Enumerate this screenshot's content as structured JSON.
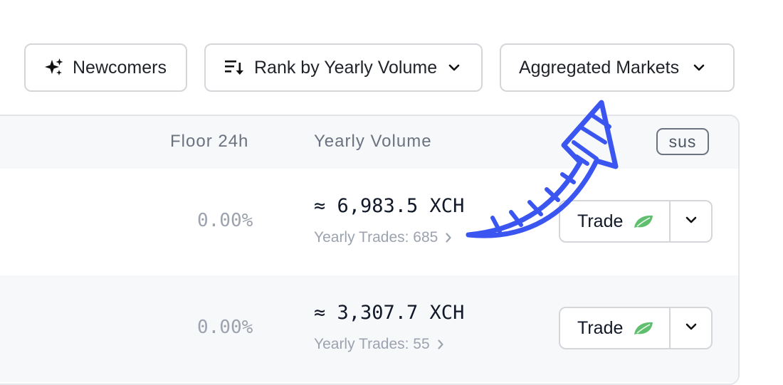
{
  "toolbar": {
    "newcomers_label": "Newcomers",
    "rank_label": "Rank by Yearly Volume",
    "markets_label": "Aggregated Markets"
  },
  "table": {
    "columns": {
      "floor": "Floor 24h",
      "volume": "Yearly Volume",
      "badge": "sus"
    },
    "rows": [
      {
        "floor": "0.00%",
        "volume": "≈ 6,983.5 XCH",
        "trades": "Yearly Trades: 685",
        "trade_label": "Trade"
      },
      {
        "floor": "0.00%",
        "volume": "≈ 3,307.7 XCH",
        "trades": "Yearly Trades: 55",
        "trade_label": "Trade"
      }
    ]
  },
  "colors": {
    "accent_arrow": "#3b55f0",
    "leaf": "#5fbf6f",
    "border": "#d4d6da"
  },
  "icons": [
    "sparkles-icon",
    "sort-icon",
    "chevron-down-icon",
    "chevron-right-icon",
    "leaf-icon",
    "hand-drawn-arrow"
  ]
}
